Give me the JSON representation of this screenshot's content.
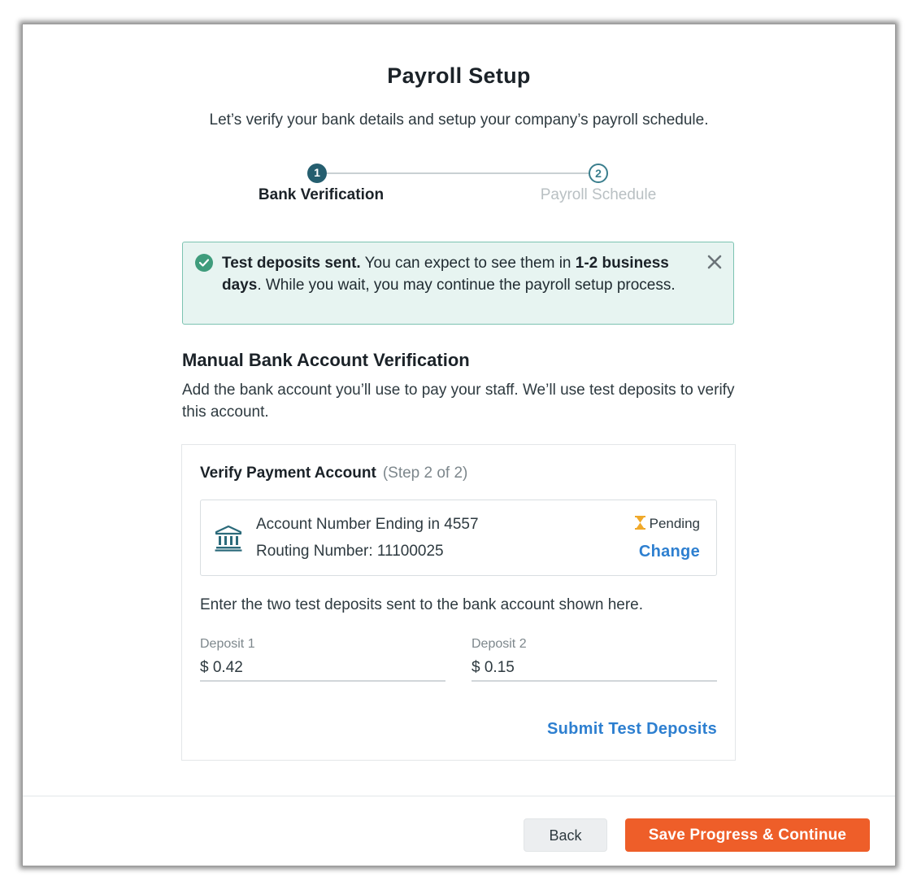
{
  "header": {
    "title": "Payroll Setup",
    "subtitle": "Let’s verify your bank details and setup your company’s payroll schedule."
  },
  "stepper": {
    "steps": [
      {
        "number": "1",
        "label": "Bank Verification",
        "state": "active"
      },
      {
        "number": "2",
        "label": "Payroll Schedule",
        "state": "inactive"
      }
    ]
  },
  "alert": {
    "bold_lead": "Test deposits sent.",
    "text_part1": " You can expect to see them in ",
    "bold_mid": "1-2 business days",
    "text_part2": ". While you wait, you may continue the payroll setup process.",
    "icon": "check-circle-icon",
    "close_icon": "close-icon"
  },
  "section": {
    "title": "Manual Bank Account Verification",
    "description": "Add the bank account you’ll use to pay your staff. We’ll use test deposits to verify this account."
  },
  "card": {
    "title": "Verify Payment Account",
    "step_note": "(Step 2 of 2)",
    "account": {
      "icon": "bank-icon",
      "account_line": "Account Number Ending in 4557",
      "routing_line": "Routing Number: 11100025",
      "status": "Pending",
      "status_icon": "hourglass-icon",
      "change_label": "Change"
    },
    "instructions": "Enter the two test deposits sent to the bank account shown here.",
    "deposit1": {
      "label": "Deposit 1",
      "value": "$ 0.42"
    },
    "deposit2": {
      "label": "Deposit 2",
      "value": "$ 0.15"
    },
    "submit_label": "Submit Test Deposits"
  },
  "footer": {
    "back_label": "Back",
    "save_label": "Save Progress & Continue"
  },
  "colors": {
    "accent_teal": "#255e6f",
    "success_green": "#3f9c7c",
    "link_blue": "#2d7fd0",
    "primary_orange": "#ee5e29",
    "pending_amber": "#f0a92a"
  }
}
